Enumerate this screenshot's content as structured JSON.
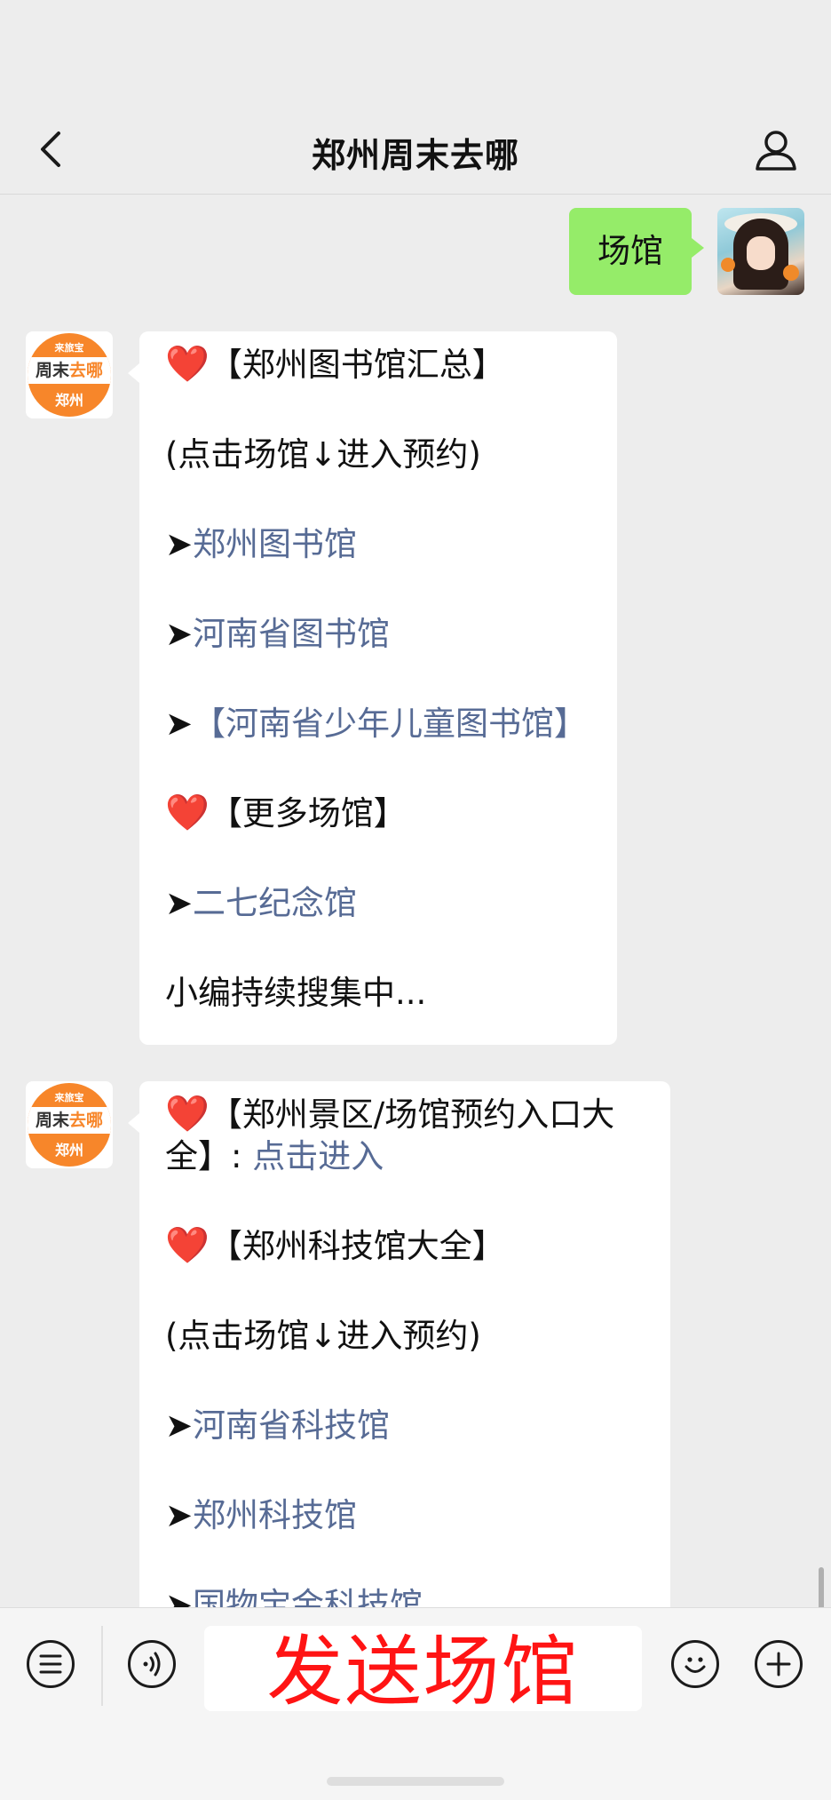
{
  "header": {
    "title": "郑州周末去哪"
  },
  "messages": {
    "user_text": "场馆",
    "bubble1": {
      "heart1": "❤️",
      "title1": "【郑州图书馆汇总】",
      "hint": "(点击场馆↓进入预约)",
      "arrow": "➤",
      "link1": "郑州图书馆",
      "link2": "河南省图书馆",
      "link3": "【河南省少年儿童图书馆】",
      "heart2": "❤️",
      "title2": "【更多场馆】",
      "link4": "二七纪念馆",
      "footer": "小编持续搜集中..."
    },
    "bubble2": {
      "heart1": "❤️",
      "title1": "【郑州景区/场馆预约入口大全】: ",
      "link_enter": "点击进入",
      "heart2": "❤️",
      "title2": "【郑州科技馆大全】",
      "hint": "(点击场馆↓进入预约)",
      "arrow": "➤",
      "link1": "河南省科技馆",
      "link2": "郑州科技馆",
      "link3_partial": "国物宝金科技馆"
    },
    "logo": {
      "top": "来旅宝",
      "band_a": "周末",
      "band_b": "去哪",
      "city": "郑州"
    }
  },
  "toolbar": {
    "input_text": "发送场馆"
  },
  "icons": [
    "back-chevron-icon",
    "profile-icon",
    "menu-list-icon",
    "voice-icon",
    "emoji-icon",
    "plus-icon"
  ]
}
